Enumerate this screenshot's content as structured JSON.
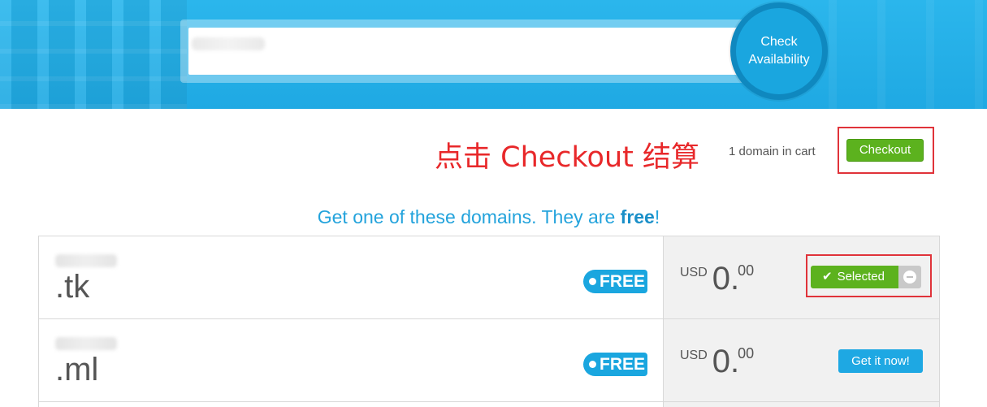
{
  "search": {
    "placeholder": "",
    "button_label_line1": "Check",
    "button_label_line2": "Availability"
  },
  "annotation": "点击 Checkout 结算",
  "cart": {
    "count_text": "1 domain in cart",
    "checkout_label": "Checkout"
  },
  "promo": {
    "text": "Get one of these domains. They are ",
    "bold": "free",
    "suffix": "!"
  },
  "domains": [
    {
      "tld": ".tk",
      "badge": "FREE",
      "currency": "USD",
      "amount": "0.",
      "cents": "00",
      "action_label": "Selected",
      "selected": true
    },
    {
      "tld": ".ml",
      "badge": "FREE",
      "currency": "USD",
      "amount": "0.",
      "cents": "00",
      "action_label": "Get it now!",
      "selected": false
    }
  ],
  "colors": {
    "brand_blue": "#1aa6df",
    "green": "#5cb21e",
    "annotation_red": "#e8282a"
  },
  "icons": {
    "selected": "check-icon",
    "remove": "minus-circle-icon",
    "badge_dot": "dot-icon"
  }
}
